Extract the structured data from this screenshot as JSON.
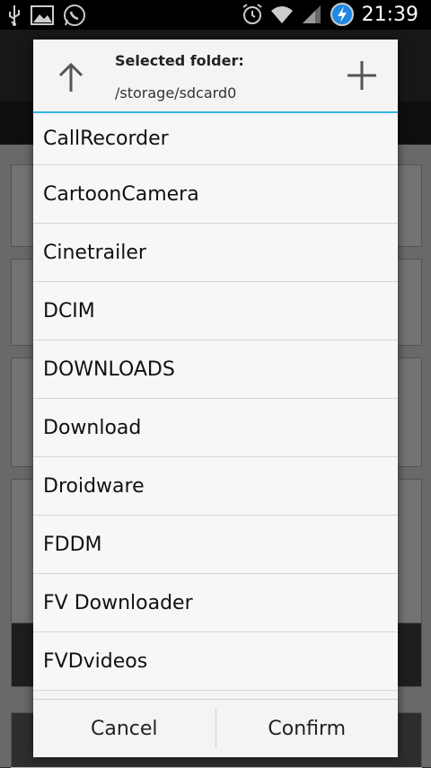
{
  "status_bar": {
    "time": "21:39",
    "icons_left": [
      "usb-icon",
      "image-icon",
      "whatsapp-icon"
    ],
    "icons_right": [
      "alarm-icon",
      "wifi-icon",
      "signal-icon",
      "battery-charging-icon"
    ]
  },
  "dialog": {
    "header_label": "Selected folder:",
    "current_path": "/storage/sdcard0",
    "folders": [
      "CallRecorder",
      "CartoonCamera",
      "Cinetrailer",
      "DCIM",
      "DOWNLOADS",
      "Download",
      "Droidware",
      "FDDM",
      "FV Downloader",
      "FVDvideos"
    ],
    "cancel_label": "Cancel",
    "confirm_label": "Confirm",
    "accent_color": "#33b5e5"
  }
}
